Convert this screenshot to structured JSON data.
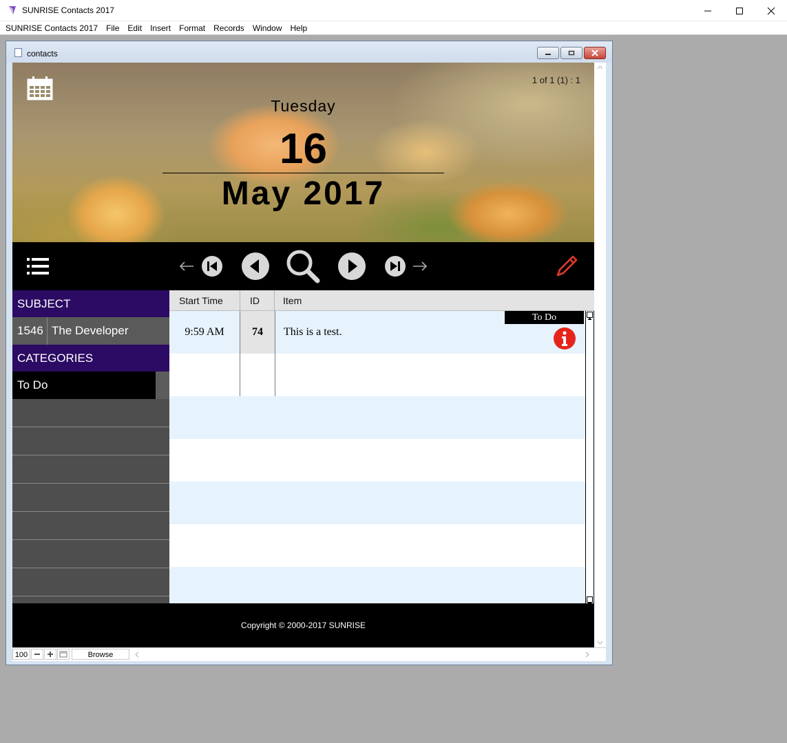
{
  "app": {
    "title": "SUNRISE Contacts 2017"
  },
  "menu": {
    "items": [
      "SUNRISE Contacts 2017",
      "File",
      "Edit",
      "Insert",
      "Format",
      "Records",
      "Window",
      "Help"
    ]
  },
  "document": {
    "title": "contacts"
  },
  "header": {
    "record_count": "1 of 1 (1) : 1",
    "day_name": "Tuesday",
    "day_number": "16",
    "month_year": "May 2017"
  },
  "sidebar": {
    "subject_label": "SUBJECT",
    "subject_id": "1546",
    "subject_name": "The Developer",
    "categories_label": "CATEGORIES",
    "selected_category": "To Do"
  },
  "table": {
    "columns": [
      "Start Time",
      "ID",
      "Item"
    ],
    "rows": [
      {
        "start_time": "9:59 AM",
        "id": "74",
        "item": "This is a test.",
        "tag": "To Do"
      }
    ]
  },
  "footer": {
    "copyright": "Copyright © 2000-2017 SUNRISE"
  },
  "status": {
    "zoom": "100",
    "mode": "Browse"
  },
  "colors": {
    "category_header": "#2b0b63",
    "row_alt": "#e6f2fc",
    "info_icon": "#e5251c",
    "edit_icon": "#e03a2a"
  }
}
